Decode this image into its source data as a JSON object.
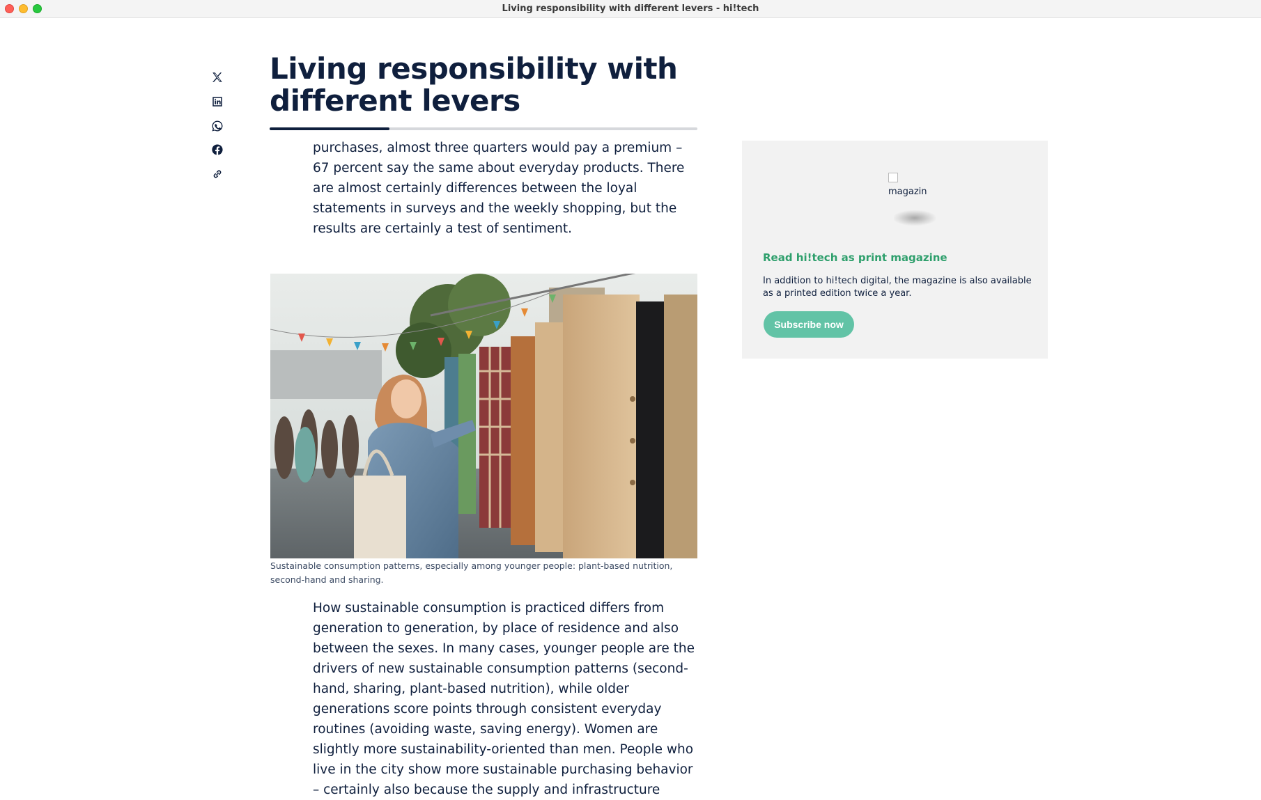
{
  "window": {
    "title": "Living responsibility with different levers - hi!tech"
  },
  "share": {
    "items": [
      {
        "icon": "x-twitter-icon",
        "label": "X"
      },
      {
        "icon": "linkedin-icon",
        "label": "LinkedIn"
      },
      {
        "icon": "whatsapp-icon",
        "label": "WhatsApp"
      },
      {
        "icon": "facebook-icon",
        "label": "Facebook"
      },
      {
        "icon": "link-icon",
        "label": "Copy link"
      }
    ]
  },
  "article": {
    "headline_line1": "Living responsibility with",
    "headline_line2": "different levers",
    "reading_progress": 0.28,
    "paragraph_1": "purchases, almost three quarters would pay a premium – 67 percent say the same about everyday products. There are almost certainly differences between the loyal statements in surveys and the weekly shopping, but the results are certainly a test of sentiment.",
    "caption": "Sustainable consumption patterns, especially among younger people: plant-based nutrition, second-hand and sharing.",
    "paragraph_2": "How sustainable consumption is practiced differs from generation to generation, by place of residence and also between the sexes. In many cases, younger people are the drivers of new sustainable consumption patterns (second-hand, sharing, plant-based nutrition), while older generations score points through consistent everyday routines (avoiding waste, saving energy). Women are slightly more sustainability-oriented than men. People who live in the city show more sustainable purchasing behavior – certainly also because the supply and infrastructure"
  },
  "promo": {
    "image_alt": "magazin",
    "title": "Read hi!tech as print magazine",
    "text": "In addition to hi!tech digital, the magazine is also available as a printed edition twice a year.",
    "button_label": "Subscribe now"
  },
  "colors": {
    "navy": "#0f1f3d",
    "promo_green": "#2e9f6c",
    "button_teal": "#62c3a6",
    "promo_bg": "#f2f2f2"
  }
}
